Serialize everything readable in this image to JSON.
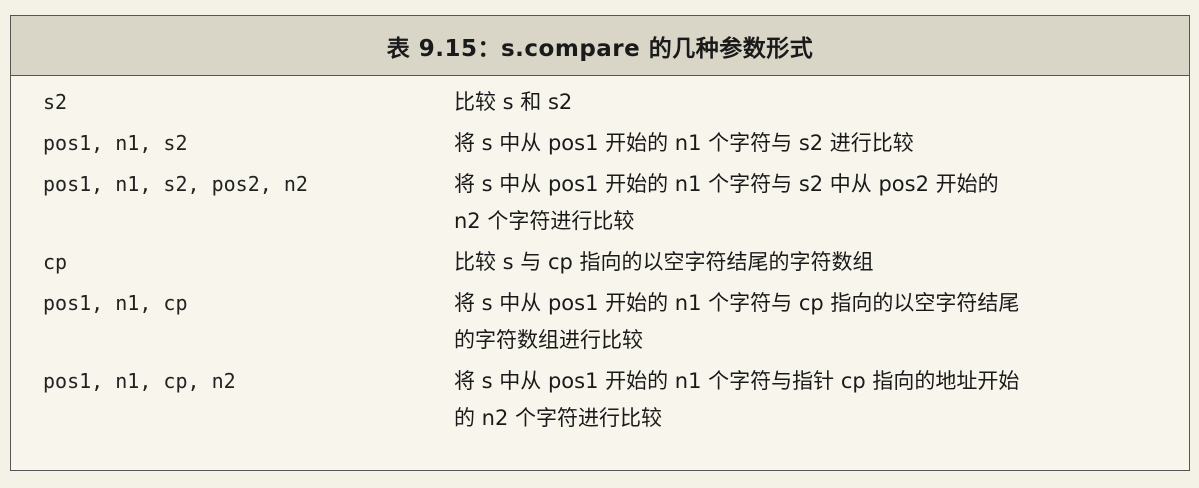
{
  "table": {
    "title": "表 9.15：s.compare 的几种参数形式",
    "rows": [
      {
        "param": "s2",
        "desc_lines": [
          "比较 s 和 s2"
        ]
      },
      {
        "param": "pos1, n1, s2",
        "desc_lines": [
          "将 s 中从 pos1 开始的 n1 个字符与 s2 进行比较"
        ]
      },
      {
        "param": "pos1, n1, s2, pos2, n2",
        "desc_lines": [
          "将 s 中从 pos1 开始的 n1 个字符与 s2 中从 pos2 开始的",
          "n2 个字符进行比较"
        ]
      },
      {
        "param": "cp",
        "desc_lines": [
          "比较 s 与 cp 指向的以空字符结尾的字符数组"
        ]
      },
      {
        "param": "pos1, n1, cp",
        "desc_lines": [
          "将 s 中从 pos1 开始的 n1 个字符与 cp 指向的以空字符结尾",
          "的字符数组进行比较"
        ]
      },
      {
        "param": "pos1, n1, cp, n2",
        "desc_lines": [
          "将 s 中从 pos1 开始的 n1 个字符与指针 cp 指向的地址开始",
          "的 n2 个字符进行比较"
        ]
      }
    ]
  }
}
